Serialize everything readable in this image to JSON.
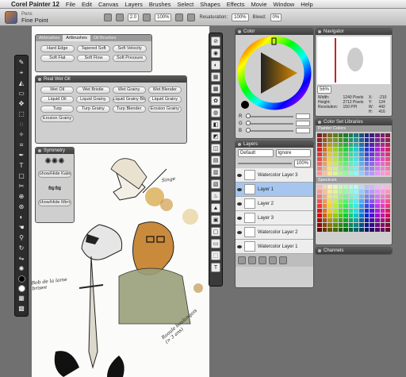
{
  "menubar": {
    "apple_icon": "apple-icon",
    "app_name": "Corel Painter 12",
    "items": [
      "File",
      "Edit",
      "Canvas",
      "Layers",
      "Brushes",
      "Select",
      "Shapes",
      "Effects",
      "Movie",
      "Window",
      "Help"
    ]
  },
  "property_bar": {
    "brush_category": "Pens",
    "brush_variant": "Fine Point",
    "size_value": "2.0",
    "opacity_value": "100%",
    "resaturation_label": "Resaturation:",
    "resaturation_value": "100%",
    "bleed_label": "Bleed:",
    "bleed_value": "0%"
  },
  "brush_panel": {
    "tabs": [
      "Airbrushes",
      "Artbrushes",
      "Oil Brushes"
    ],
    "active_tab": "Artbrushes",
    "buttons": [
      "Hard Edge",
      "Tapered Soft",
      "Soft Velocity",
      "Soft Flat",
      "Soft Flow",
      "Soft Pressure"
    ]
  },
  "oil_panel": {
    "title": "Real Wet Oil",
    "buttons": [
      "Wet Oil",
      "Wet Bristle",
      "Wet Grainy",
      "Wet Blender",
      "Liquid Oil",
      "Liquid Grainy",
      "Liquid Grainy Ble...",
      "Liquid Grainy",
      "Turp",
      "Turp Grainy",
      "Turp Blender",
      "Erosion Grainy",
      "Erosion Grainy"
    ]
  },
  "symmetry_panel": {
    "title": "Symmetry",
    "buttons": [
      "Show/Hide Kalei...",
      "Show/Hide Mirrors"
    ]
  },
  "color_panel": {
    "title": "Color",
    "slider_labels": [
      "R",
      "G",
      "B"
    ],
    "hue_colors": [
      "#ff0000",
      "#ffff00",
      "#00ff00",
      "#00ffff",
      "#0000ff",
      "#ff00ff",
      "#ff0000"
    ],
    "current_color": "#000000"
  },
  "navigator_panel": {
    "title": "Navigator",
    "zoom": "56%",
    "info": [
      {
        "label": "Width:",
        "value": "1240 Pixels",
        "k": "X:",
        "v": "-210"
      },
      {
        "label": "Height:",
        "value": "2712 Pixels",
        "k": "Y:",
        "v": "124"
      },
      {
        "label": "Resolution:",
        "value": "150 PPI",
        "k": "W:",
        "v": "442"
      },
      {
        "label": "",
        "value": "",
        "k": "H:",
        "v": "416"
      }
    ]
  },
  "color_set_panel": {
    "title": "Color Set Libraries",
    "set_name": "Painter Colors",
    "spectrum_name": "Spectrum"
  },
  "channels_panel": {
    "title": "Channels"
  },
  "layers_panel": {
    "title": "Layers",
    "composite_method": "Default",
    "composite_depth": "Ignore",
    "opacity": "100%",
    "layers": [
      {
        "name": "Watercolor Layer 3",
        "selected": false
      },
      {
        "name": "Layer 1",
        "selected": true
      },
      {
        "name": "Layer 2",
        "selected": false
      },
      {
        "name": "Layer 3",
        "selected": false
      },
      {
        "name": "Watercolor Layer 2",
        "selected": false
      },
      {
        "name": "Watercolor Layer 1",
        "selected": false
      }
    ]
  },
  "artwork_annotations": [
    "Singe",
    "Bob de la lame brisee",
    "Raoule boulangais (> 3 ans)"
  ]
}
